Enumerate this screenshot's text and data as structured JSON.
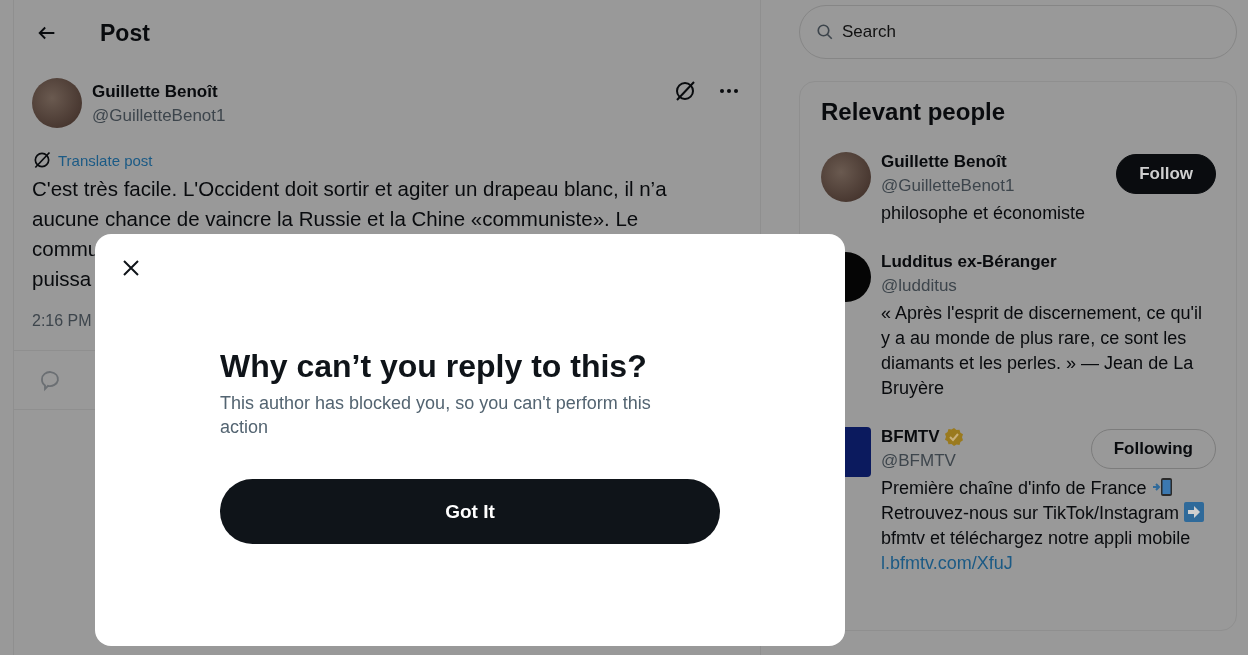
{
  "header": {
    "title": "Post"
  },
  "post": {
    "author": {
      "name": "Guillette Benoît",
      "handle": "@GuilletteBenot1"
    },
    "translate": "Translate post",
    "text_lines": [
      "C'est très facile. L'Occident doit sortir et agiter un drapeau blanc, il n’a",
      "aucune chance de vaincre la Russie et la Chine «communiste». Le",
      "commu",
      "puissa"
    ],
    "time": "2:16 PM"
  },
  "search": {
    "placeholder": "Search"
  },
  "relevant_people": {
    "title": "Relevant people",
    "people": [
      {
        "name": "Guillette Benoît",
        "handle": "@GuilletteBenot1",
        "verified": false,
        "kind": "photo",
        "button": {
          "label": "Follow",
          "following": false
        },
        "bio": [
          {
            "kind": "text",
            "text": "philosophe et économiste"
          }
        ]
      },
      {
        "name": "Ludditus ex-Béranger",
        "handle": "@ludditus",
        "verified": false,
        "kind": "dark",
        "bio": [
          {
            "kind": "text",
            "text": "« Après l'esprit de discernement, ce qu'il y a au monde de plus rare, ce sont les diamants et les perles. » — Jean de La Bruyère"
          }
        ]
      },
      {
        "name": "BFMTV",
        "handle": "@BFMTV",
        "verified": true,
        "kind": "logo",
        "button": {
          "label": "Following",
          "following": true
        },
        "bio": [
          {
            "kind": "text",
            "text": "Première chaîne d'info de France "
          },
          {
            "kind": "phone"
          },
          {
            "kind": "text",
            "text": " Retrouvez-nous sur TikTok/Instagram "
          },
          {
            "kind": "arrow"
          },
          {
            "kind": "text",
            "text": " bfmtv et téléchargez notre appli mobile "
          },
          {
            "kind": "link",
            "text": "l.bfmtv.com/XfuJ"
          }
        ]
      }
    ]
  },
  "dialog": {
    "title": "Why can’t you reply to this?",
    "message": "This author has blocked you, so you can't perform this action",
    "button": "Got It"
  }
}
